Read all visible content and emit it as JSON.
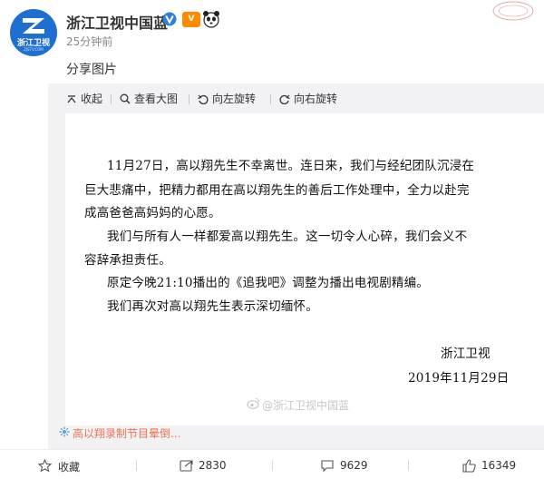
{
  "header": {
    "username": "浙江卫视中国蓝",
    "time": "25分钟前",
    "post_text": "分享图片",
    "avatar_text": "浙江卫视",
    "avatar_sub": "ZJSTV.COM",
    "member_badge": "V"
  },
  "toolbar": {
    "collapse": "收起",
    "view_large": "查看大图",
    "rotate_left": "向左旋转",
    "rotate_right": "向右旋转"
  },
  "document": {
    "lines": [
      "11月27日，高以翔先生不幸离世。连日来，我们与经纪团队沉浸在",
      "巨大悲痛中，把精力都用在高以翔先生的善后工作处理中，全力以赴完",
      "成高爸爸高妈妈的心愿。",
      "我们与所有人一样都爱高以翔先生。这一切令人心碎，我们会义不",
      "容辞承担责任。",
      "原定今晚21:10播出的《追我吧》调整为播出电视剧精编。",
      "我们再次对高以翔先生表示深切缅怀。"
    ],
    "signature": "浙江卫视",
    "date": "2019年11月29日",
    "watermark": "@浙江卫视中国蓝"
  },
  "topic": "高以翔录制节目晕倒...",
  "footer": {
    "favorite": "收藏",
    "repost": "2830",
    "comment": "9629",
    "like": "16349"
  },
  "colors": {
    "accent": "#eb7350",
    "avatar_bg": "#1e6fd0",
    "verified": "#2f7fe0"
  }
}
